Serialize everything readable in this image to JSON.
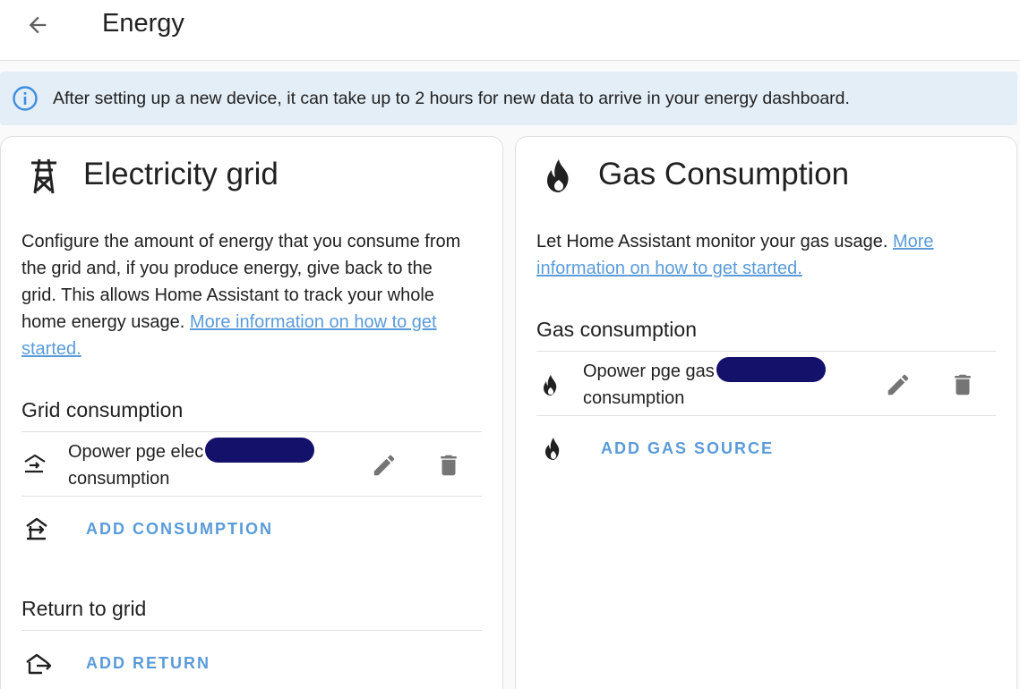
{
  "header": {
    "back_icon": "arrow-left-icon",
    "title": "Energy"
  },
  "banner": {
    "icon": "info-circle-icon",
    "text": "After setting up a new device, it can take up to 2 hours for new data to arrive in your energy dashboard."
  },
  "grid_card": {
    "icon": "transmission-tower-icon",
    "title": "Electricity grid",
    "description": "Configure the amount of energy that you consume from the grid and, if you produce energy, give back to the grid. This allows Home Assistant to track your whole home energy usage.",
    "link_text": "More information on how to get started.",
    "consumption": {
      "title": "Grid consumption",
      "source_name_prefix": "Opower pge elec",
      "source_name_suffix": "consumption",
      "source_icon": "transmission-tower-import-icon",
      "edit_icon": "pencil-icon",
      "delete_icon": "trash-icon",
      "add_label": "ADD CONSUMPTION",
      "add_icon": "transmission-tower-import-icon"
    },
    "return": {
      "title": "Return to grid",
      "add_label": "ADD RETURN",
      "add_icon": "transmission-tower-export-icon"
    }
  },
  "gas_card": {
    "icon": "fire-icon",
    "title": "Gas Consumption",
    "description": "Let Home Assistant monitor your gas usage.",
    "link_text": "More information on how to get started.",
    "consumption": {
      "title": "Gas consumption",
      "source_name_prefix": "Opower pge gas",
      "source_name_suffix": "consumption",
      "source_icon": "fire-icon",
      "edit_icon": "pencil-icon",
      "delete_icon": "trash-icon",
      "add_label": "ADD GAS SOURCE",
      "add_icon": "fire-icon"
    }
  },
  "colors": {
    "accent": "#5a9bd9",
    "banner_bg": "#e4eef7",
    "icon_gray": "#757575",
    "redaction": "#14116b"
  }
}
